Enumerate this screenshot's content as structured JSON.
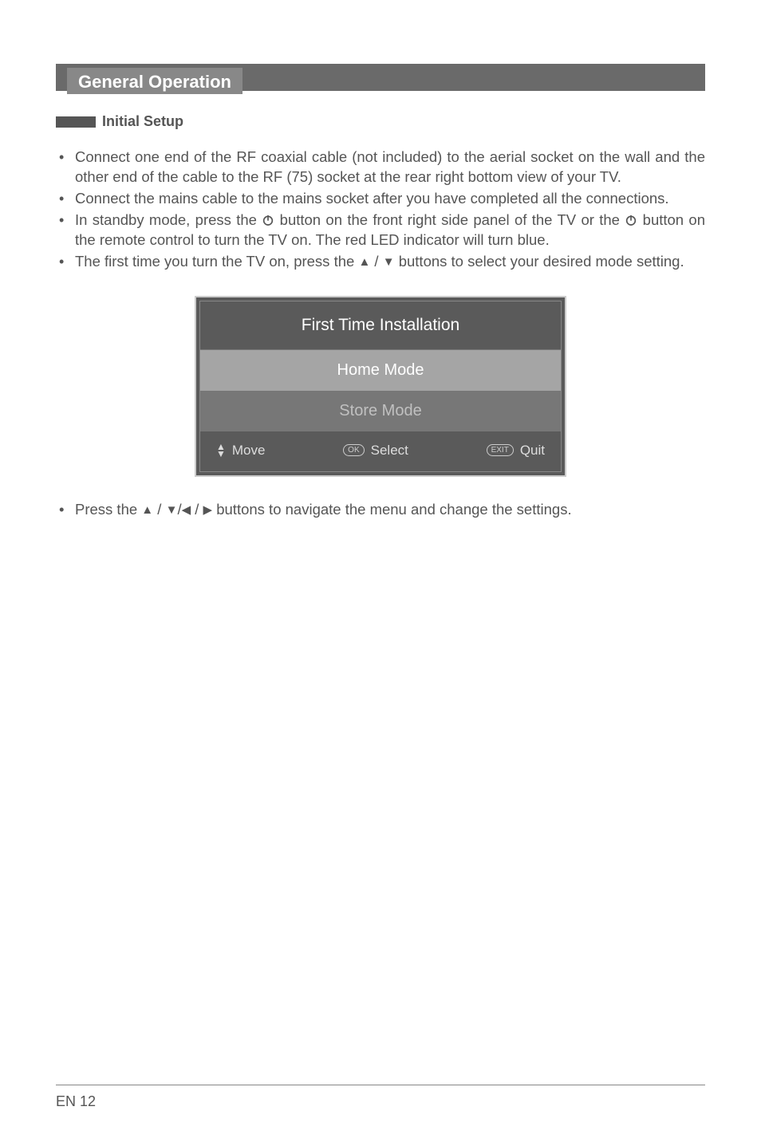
{
  "page": {
    "section_title": "General Operation",
    "subheading": "Initial Setup",
    "bullets": {
      "b1": "Connect one end of the RF coaxial cable (not included) to the aerial socket on the wall and the other end of the cable to the RF (75) socket at the rear right bottom view of your TV.",
      "b2": "Connect the mains cable to the mains socket after you have completed all the connections.",
      "b3a": "In standby mode, press the ",
      "b3b": " button on the front right side panel of the TV or the ",
      "b3c": " button on the remote control to turn the TV on. The red LED indicator will turn blue.",
      "b4a": "The first time you turn the TV on, press the ",
      "b4b": " buttons to select your desired mode setting."
    },
    "osd": {
      "title": "First Time Installation",
      "option_home": "Home Mode",
      "option_store": "Store Mode",
      "footer": {
        "move": "Move",
        "ok_key": "OK",
        "select": "Select",
        "exit_key": "EXIT",
        "quit": "Quit"
      }
    },
    "lower_a": "Press the ",
    "lower_b": " buttons to navigate the menu and change the settings.",
    "footer": "EN 12"
  }
}
